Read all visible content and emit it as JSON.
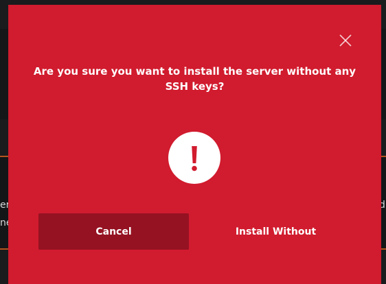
{
  "background": {
    "fragments": [
      "er",
      "ne",
      "d"
    ]
  },
  "dialog": {
    "title": "Are you sure you want to install the server without any SSH keys?",
    "close_icon": "close-icon",
    "alert_icon": "exclamation-icon",
    "cancel_label": "Cancel",
    "confirm_label": "Install Without"
  },
  "colors": {
    "dialog_bg": "#d11b2e",
    "cancel_bg": "#951222",
    "accent_line": "#b4541e",
    "text": "#ffffff"
  }
}
